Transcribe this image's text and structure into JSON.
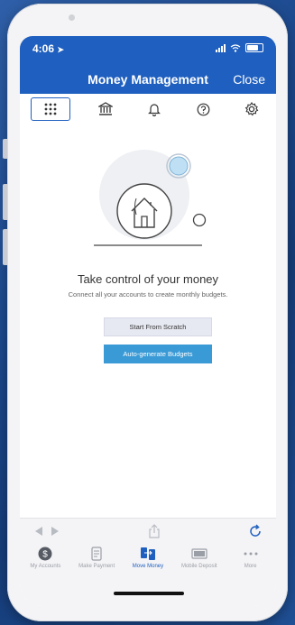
{
  "status": {
    "time": "4:06"
  },
  "header": {
    "title": "Money Management",
    "close_label": "Close"
  },
  "icon_tabs": [
    {
      "icon": "grid-icon",
      "active": true
    },
    {
      "icon": "bank-icon"
    },
    {
      "icon": "bell-icon"
    },
    {
      "icon": "help-icon"
    },
    {
      "icon": "gear-icon"
    }
  ],
  "main": {
    "heading": "Take control of your money",
    "subheading": "Connect all your accounts to create monthly budgets.",
    "start_button": "Start From Scratch",
    "auto_button": "Auto-generate Budgets"
  },
  "nav": {
    "items": [
      {
        "label": "My Accounts",
        "icon": "dollar-icon"
      },
      {
        "label": "Make Payment",
        "icon": "payment-icon"
      },
      {
        "label": "Move Money",
        "icon": "transfer-icon",
        "active": true
      },
      {
        "label": "Mobile Deposit",
        "icon": "check-icon"
      },
      {
        "label": "More",
        "icon": "more-icon"
      }
    ]
  },
  "colors": {
    "primary": "#1f5fbf",
    "accent": "#3a9ad6"
  }
}
